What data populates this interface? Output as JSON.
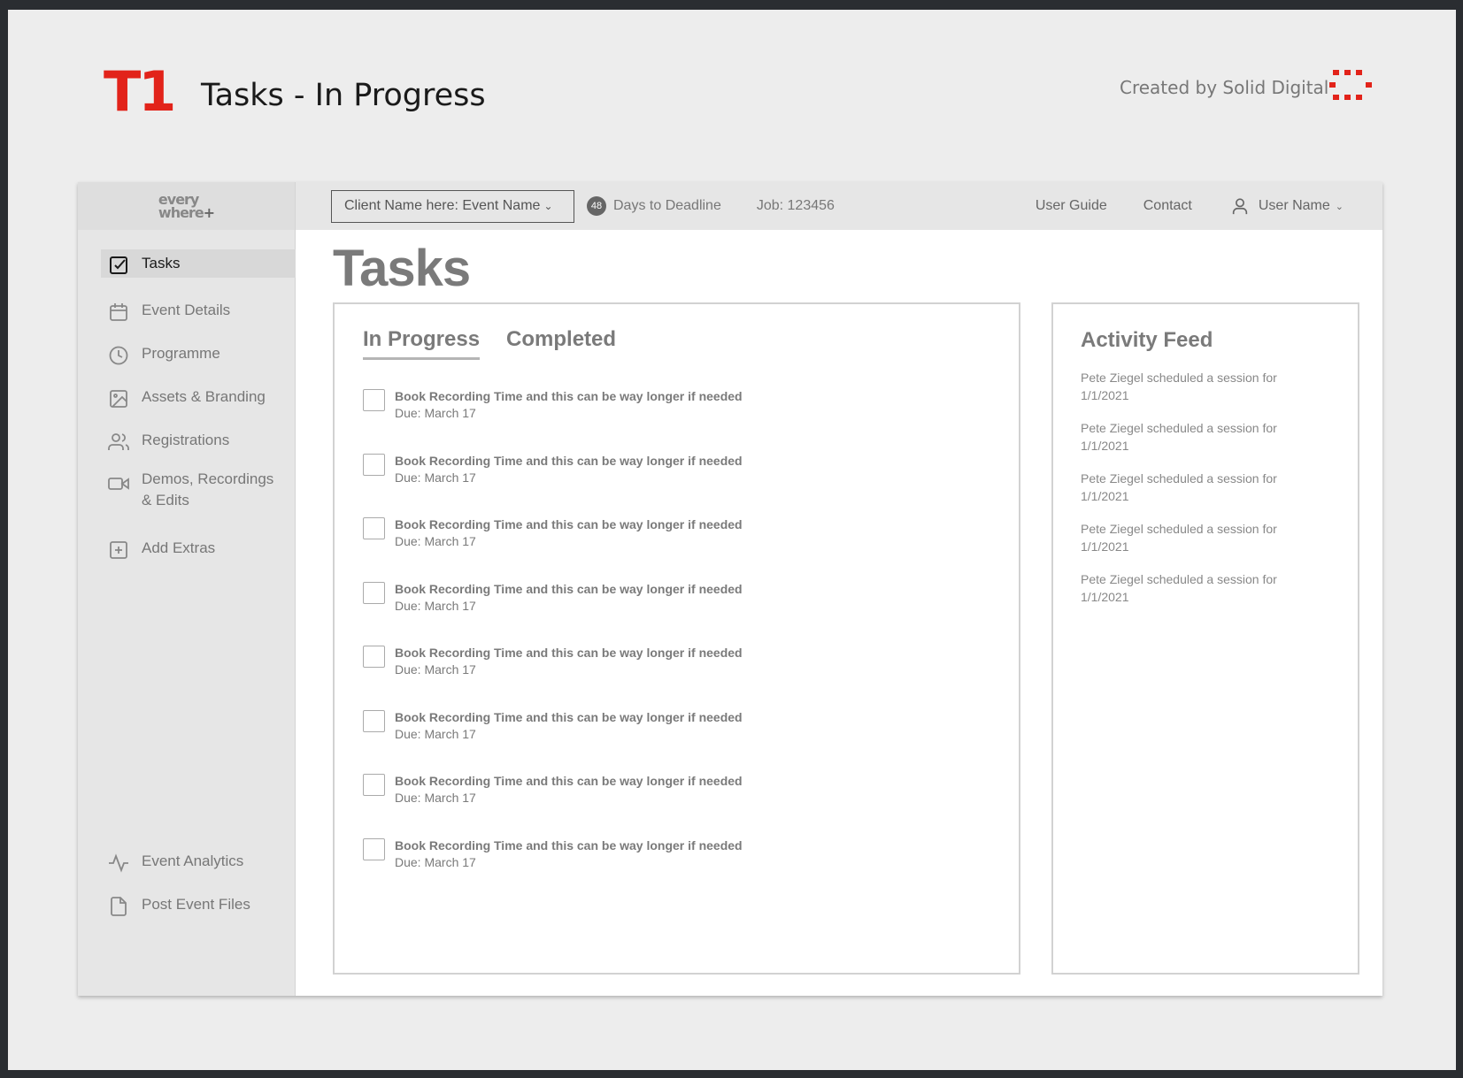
{
  "board": {
    "logo_text": "T1",
    "title": "Tasks - In Progress",
    "credit": "Created by Solid Digital",
    "brand_color": "#e2231a"
  },
  "app": {
    "logo_line1": "every",
    "logo_line2": "where",
    "sidebar": {
      "items": [
        {
          "label": "Tasks",
          "icon": "checkbox-icon",
          "active": true
        },
        {
          "label": "Event Details",
          "icon": "calendar-icon"
        },
        {
          "label": "Programme",
          "icon": "clock-icon"
        },
        {
          "label": "Assets & Branding",
          "icon": "image-icon"
        },
        {
          "label": "Registrations",
          "icon": "users-icon"
        },
        {
          "label": "Demos, Recordings & Edits",
          "icon": "video-icon"
        },
        {
          "label": "Add Extras",
          "icon": "plus-square-icon"
        }
      ],
      "bottom_items": [
        {
          "label": "Event Analytics",
          "icon": "activity-icon"
        },
        {
          "label": "Post Event Files",
          "icon": "file-icon"
        }
      ]
    },
    "topbar": {
      "client_select": "Client Name here: Event Name",
      "days_count": "48",
      "days_label": "Days to Deadline",
      "job": "Job: 123456",
      "user_guide": "User Guide",
      "contact": "Contact",
      "user_name": "User Name"
    },
    "page_title": "Tasks",
    "tabs": [
      {
        "label": "In Progress",
        "active": true
      },
      {
        "label": "Completed"
      }
    ],
    "tasks": [
      {
        "title": "Book Recording Time and this can be way longer if needed",
        "due": "Due: March 17"
      },
      {
        "title": "Book Recording Time and this can be way longer if needed",
        "due": "Due: March 17"
      },
      {
        "title": "Book Recording Time and this can be way longer if needed",
        "due": "Due: March 17"
      },
      {
        "title": "Book Recording Time and this can be way longer if needed",
        "due": "Due: March 17"
      },
      {
        "title": "Book Recording Time and this can be way longer if needed",
        "due": "Due: March 17"
      },
      {
        "title": "Book Recording Time and this can be way longer if needed",
        "due": "Due: March 17"
      },
      {
        "title": "Book Recording Time and this can be way longer if needed",
        "due": "Due: March 17"
      },
      {
        "title": "Book Recording Time and this can be way longer if needed",
        "due": "Due: March 17"
      }
    ],
    "activity_feed": {
      "title": "Activity Feed",
      "items": [
        {
          "text": "Pete Ziegel scheduled a session for",
          "date": "1/1/2021"
        },
        {
          "text": "Pete Ziegel scheduled a session for",
          "date": "1/1/2021"
        },
        {
          "text": "Pete Ziegel scheduled a session for",
          "date": "1/1/2021"
        },
        {
          "text": "Pete Ziegel scheduled a session for",
          "date": "1/1/2021"
        },
        {
          "text": "Pete Ziegel scheduled a session for",
          "date": "1/1/2021"
        }
      ]
    }
  }
}
